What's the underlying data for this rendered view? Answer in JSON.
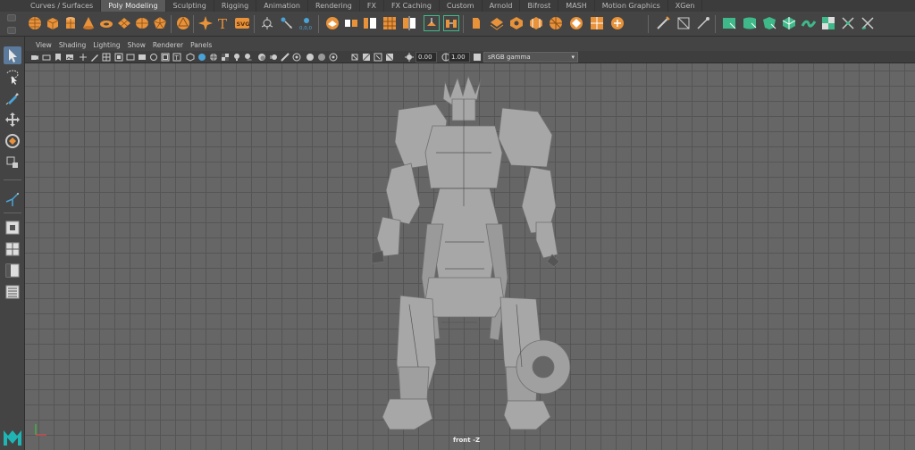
{
  "shelf_tabs": [
    "Curves / Surfaces",
    "Poly Modeling",
    "Sculpting",
    "Rigging",
    "Animation",
    "Rendering",
    "FX",
    "FX Caching",
    "Custom",
    "Arnold",
    "Bifrost",
    "MASH",
    "Motion Graphics",
    "XGen"
  ],
  "active_tab": "Poly Modeling",
  "panel_menus": [
    "View",
    "Shading",
    "Lighting",
    "Show",
    "Renderer",
    "Panels"
  ],
  "panel_toolbar": {
    "exposure_value": "0.00",
    "gamma_value": "1.00",
    "color_space": "sRGB gamma"
  },
  "viewport": {
    "camera_label": "front -Z"
  },
  "colors": {
    "accent_orange": "#e8923a",
    "accent_green": "#3fb98a",
    "selected_tool": "#5b7a9c"
  }
}
